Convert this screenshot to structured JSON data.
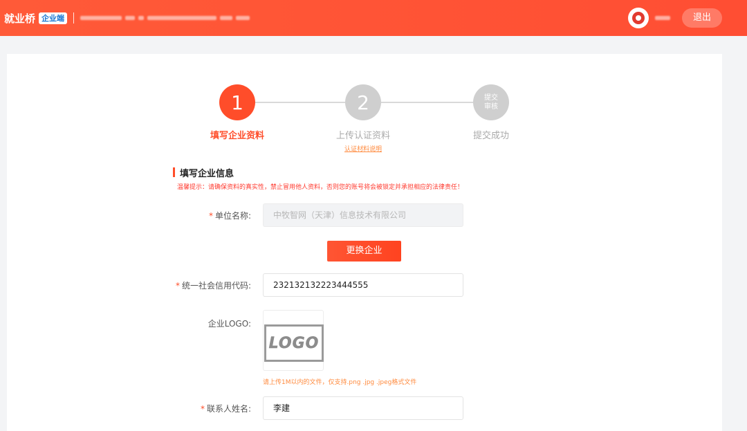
{
  "header": {
    "brand_name": "就业桥",
    "brand_tag": "企业端",
    "logout_label": "退出"
  },
  "steps": [
    {
      "number": "1",
      "label": "填写企业资料",
      "state": "active"
    },
    {
      "number": "2",
      "label": "上传认证资料",
      "state": "todo",
      "sub_link": "认证材料说明"
    },
    {
      "number_lines": [
        "提交",
        "审核"
      ],
      "label": "提交成功",
      "state": "todo"
    }
  ],
  "section": {
    "title": "填写企业信息",
    "tip": "温馨提示：请确保资料的真实性，禁止冒用他人资料，否则您的账号将会被锁定并承担相应的法律责任！"
  },
  "form": {
    "company_name": {
      "label": "单位名称:",
      "required": "*",
      "value": "中牧智网（天津）信息技术有限公司"
    },
    "change_button": "更换企业",
    "credit_code": {
      "label": "统一社会信用代码:",
      "required": "*",
      "value": "232132132223444555"
    },
    "logo": {
      "label": "企业LOGO:",
      "placeholder_text": "LOGO",
      "hint": "请上传1M以内的文件，仅支持.png .jpg .jpeg格式文件"
    },
    "contact_name": {
      "label": "联系人姓名:",
      "required": "*",
      "value": "李建"
    }
  },
  "colors": {
    "accent": "#ff4d2a",
    "header_bg": "#ff5a38",
    "link_orange": "#ff8a3d",
    "warning_red": "#ff3b30"
  }
}
